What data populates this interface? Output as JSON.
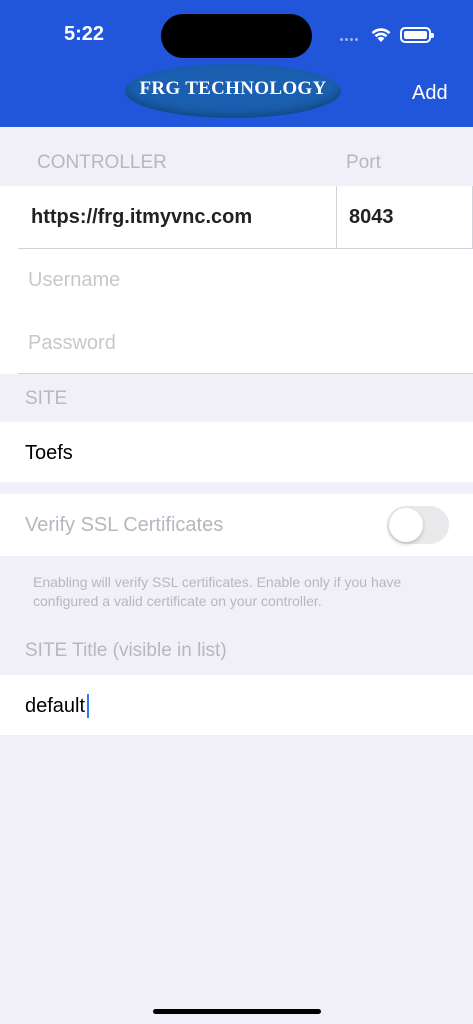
{
  "status_bar": {
    "time": "5:22"
  },
  "nav": {
    "logo_text": "FRG TECHNOLOGY",
    "add_label": "Add"
  },
  "controller": {
    "section_label": "CONTROLLER",
    "port_label": "Port",
    "url_value": "https://frg.itmyvnc.com",
    "port_value": "8043",
    "username_placeholder": "Username",
    "password_placeholder": "Password"
  },
  "site": {
    "section_label": "SITE",
    "value": "Toefs"
  },
  "ssl": {
    "label": "Verify SSL Certificates",
    "enabled": false,
    "footnote": "Enabling will verify SSL certificates. Enable only if you have configured a valid certificate on your controller."
  },
  "site_title": {
    "section_label": "SITE Title (visible in list)",
    "value": "default"
  }
}
